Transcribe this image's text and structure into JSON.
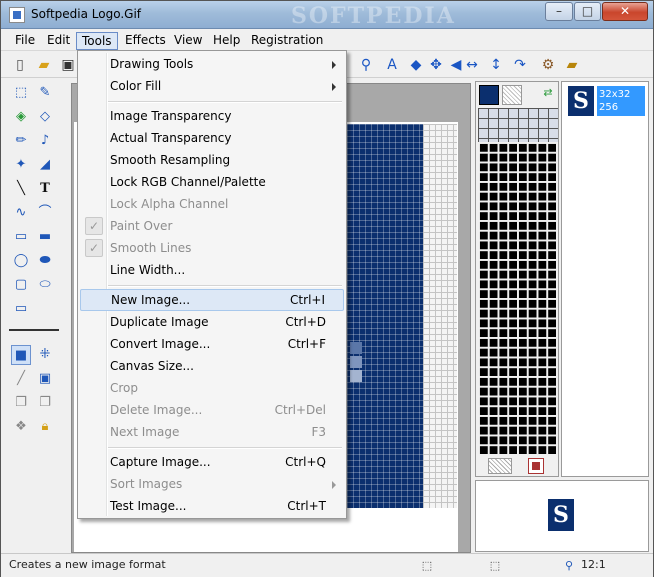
{
  "window": {
    "title": "Softpedia Logo.Gif",
    "watermark": "SOFTPEDIA",
    "controls": {
      "minimize": "–",
      "maximize": "□",
      "close": "✕"
    }
  },
  "menubar": {
    "items": [
      {
        "label": "File"
      },
      {
        "label": "Edit"
      },
      {
        "label": "Tools"
      },
      {
        "label": "Effects"
      },
      {
        "label": "View"
      },
      {
        "label": "Help"
      },
      {
        "label": "Registration"
      }
    ]
  },
  "toolbar": {
    "icons": [
      "new-icon",
      "open-icon",
      "save-icon",
      "zoom-icon",
      "text-select-icon",
      "move-all-icon",
      "move-vertical-icon",
      "flip-horizontal-icon",
      "flip-vertical-icon",
      "rotate-icon",
      "tools-icon",
      "book-icon"
    ]
  },
  "tools_menu": {
    "items": [
      {
        "label": "Drawing Tools",
        "submenu": true
      },
      {
        "label": "Color Fill",
        "submenu": true
      },
      {
        "label": "Image Transparency"
      },
      {
        "label": "Actual Transparency"
      },
      {
        "label": "Smooth Resampling"
      },
      {
        "label": "Lock RGB Channel/Palette"
      },
      {
        "label": "Lock Alpha Channel",
        "disabled": true
      },
      {
        "label": "Paint Over",
        "disabled": true,
        "checked": true
      },
      {
        "label": "Smooth Lines",
        "disabled": true,
        "checked": true
      },
      {
        "label": "Line Width..."
      },
      {
        "label": "New Image...",
        "shortcut": "Ctrl+I",
        "highlighted": true
      },
      {
        "label": "Duplicate Image",
        "shortcut": "Ctrl+D"
      },
      {
        "label": "Convert Image...",
        "shortcut": "Ctrl+F"
      },
      {
        "label": "Canvas Size..."
      },
      {
        "label": "Crop",
        "disabled": true
      },
      {
        "label": "Delete Image...",
        "shortcut": "Ctrl+Del",
        "disabled": true
      },
      {
        "label": "Next Image",
        "shortcut": "F3",
        "disabled": true
      },
      {
        "label": "Capture Image...",
        "shortcut": "Ctrl+Q"
      },
      {
        "label": "Sort Images",
        "submenu": true,
        "disabled": true
      },
      {
        "label": "Test Image...",
        "shortcut": "Ctrl+T"
      }
    ],
    "check_glyph": "✓"
  },
  "image_list": {
    "thumb_letter": "S",
    "size": "32x32",
    "colors": "256"
  },
  "preview": {
    "letter": "S"
  },
  "statusbar": {
    "message": "Creates a new image format",
    "zoom": "12:1"
  },
  "colors": {
    "logo_blue": "#0b2f6e",
    "selection_blue": "#3399ff",
    "menu_highlight": "#dde8f6"
  }
}
